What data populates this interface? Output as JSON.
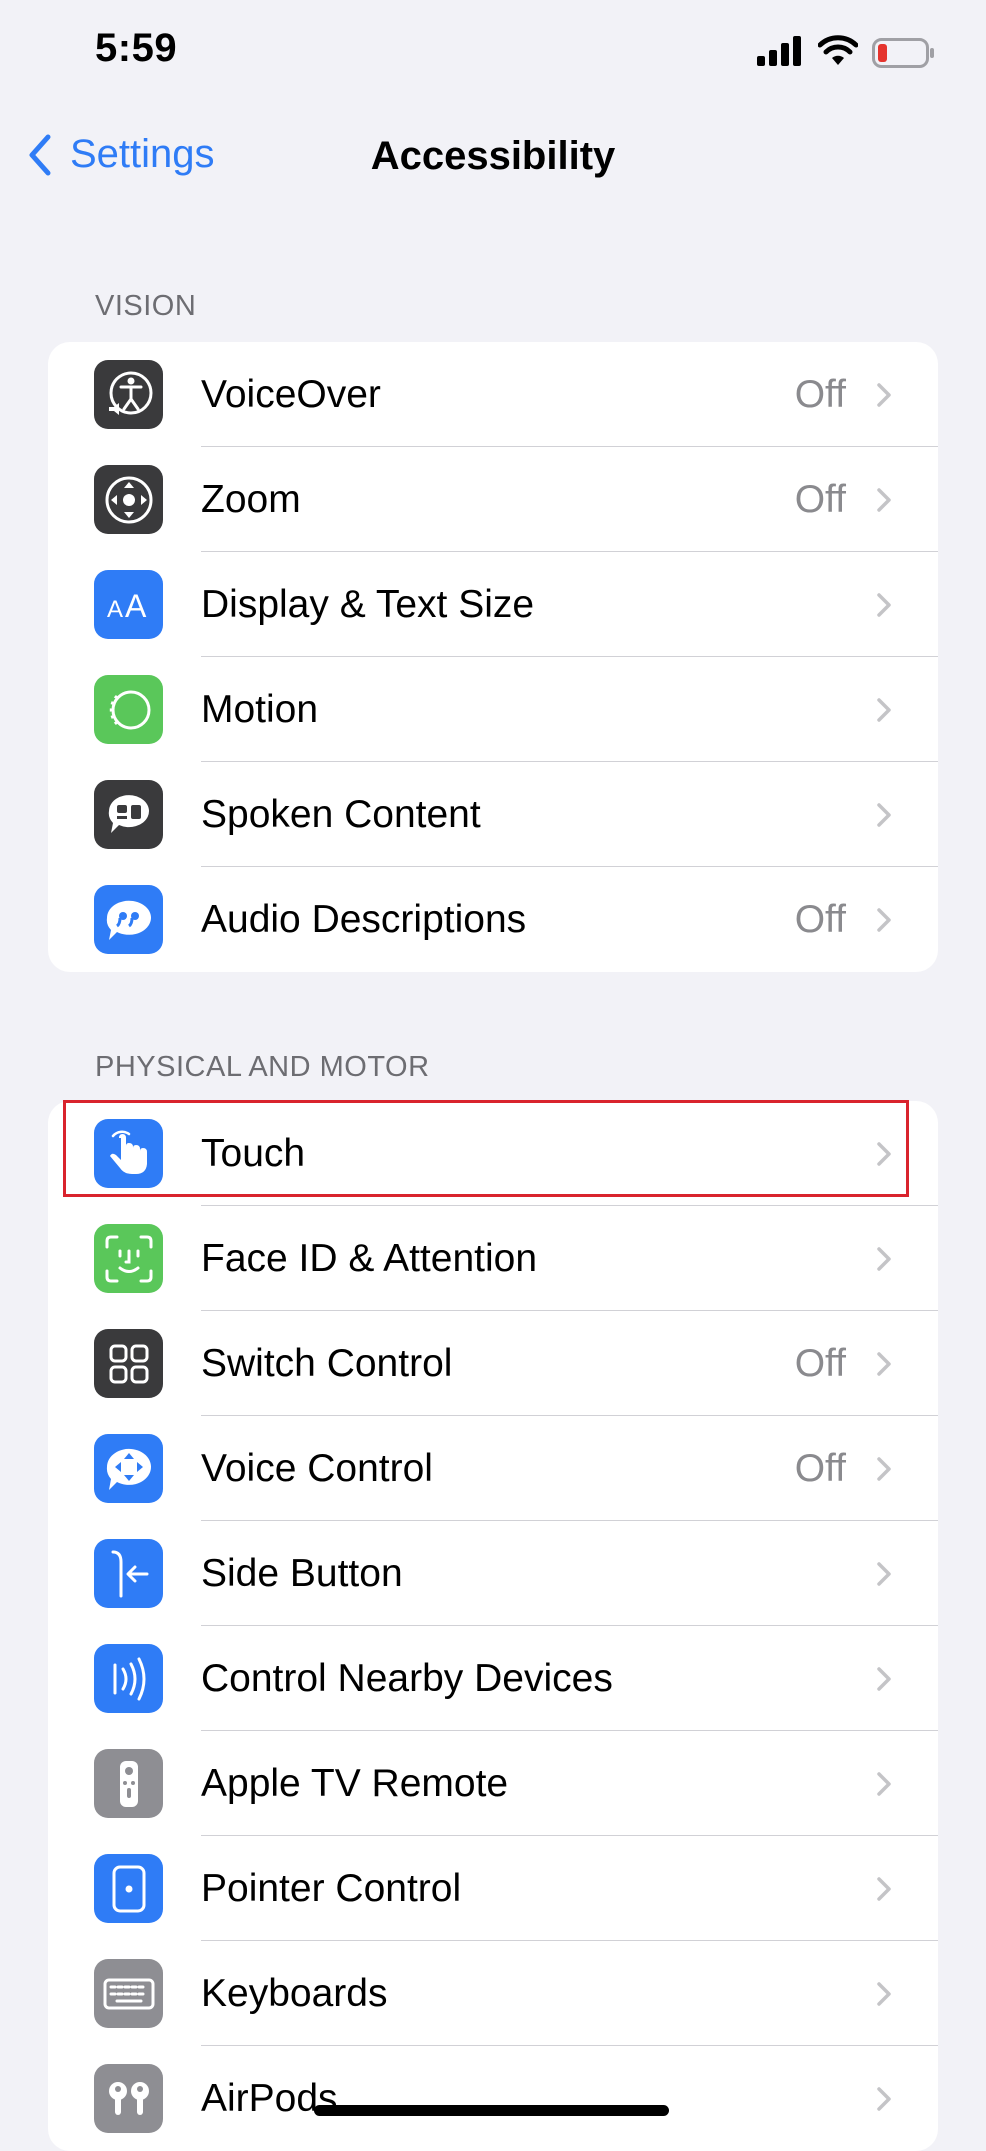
{
  "status_bar": {
    "time": "5:59",
    "battery_color": "#e5342e"
  },
  "nav": {
    "back_label": "Settings",
    "title": "Accessibility",
    "accent": "#2f7cf6"
  },
  "sections": [
    {
      "header": "VISION",
      "items": [
        {
          "label": "VoiceOver",
          "value": "Off",
          "icon": "voiceover-icon",
          "icon_bg": "#3a3a3c"
        },
        {
          "label": "Zoom",
          "value": "Off",
          "icon": "zoom-icon",
          "icon_bg": "#3a3a3c"
        },
        {
          "label": "Display & Text Size",
          "value": "",
          "icon": "display-text-size-icon",
          "icon_bg": "#2f7cf6"
        },
        {
          "label": "Motion",
          "value": "",
          "icon": "motion-icon",
          "icon_bg": "#5ac75a"
        },
        {
          "label": "Spoken Content",
          "value": "",
          "icon": "spoken-content-icon",
          "icon_bg": "#3a3a3c"
        },
        {
          "label": "Audio Descriptions",
          "value": "Off",
          "icon": "audio-descriptions-icon",
          "icon_bg": "#2f7cf6"
        }
      ]
    },
    {
      "header": "PHYSICAL AND MOTOR",
      "items": [
        {
          "label": "Touch",
          "value": "",
          "icon": "touch-icon",
          "icon_bg": "#2f7cf6"
        },
        {
          "label": "Face ID & Attention",
          "value": "",
          "icon": "face-id-icon",
          "icon_bg": "#5ac75a"
        },
        {
          "label": "Switch Control",
          "value": "Off",
          "icon": "switch-control-icon",
          "icon_bg": "#3a3a3c"
        },
        {
          "label": "Voice Control",
          "value": "Off",
          "icon": "voice-control-icon",
          "icon_bg": "#2f7cf6"
        },
        {
          "label": "Side Button",
          "value": "",
          "icon": "side-button-icon",
          "icon_bg": "#2f7cf6"
        },
        {
          "label": "Control Nearby Devices",
          "value": "",
          "icon": "control-nearby-devices-icon",
          "icon_bg": "#2f7cf6"
        },
        {
          "label": "Apple TV Remote",
          "value": "",
          "icon": "apple-tv-remote-icon",
          "icon_bg": "#8e8e93"
        },
        {
          "label": "Pointer Control",
          "value": "",
          "icon": "pointer-control-icon",
          "icon_bg": "#2f7cf6"
        },
        {
          "label": "Keyboards",
          "value": "",
          "icon": "keyboards-icon",
          "icon_bg": "#8e8e93"
        },
        {
          "label": "AirPods",
          "value": "",
          "icon": "airpods-icon",
          "icon_bg": "#8e8e93"
        }
      ]
    }
  ],
  "highlight_color": "#d9232d"
}
